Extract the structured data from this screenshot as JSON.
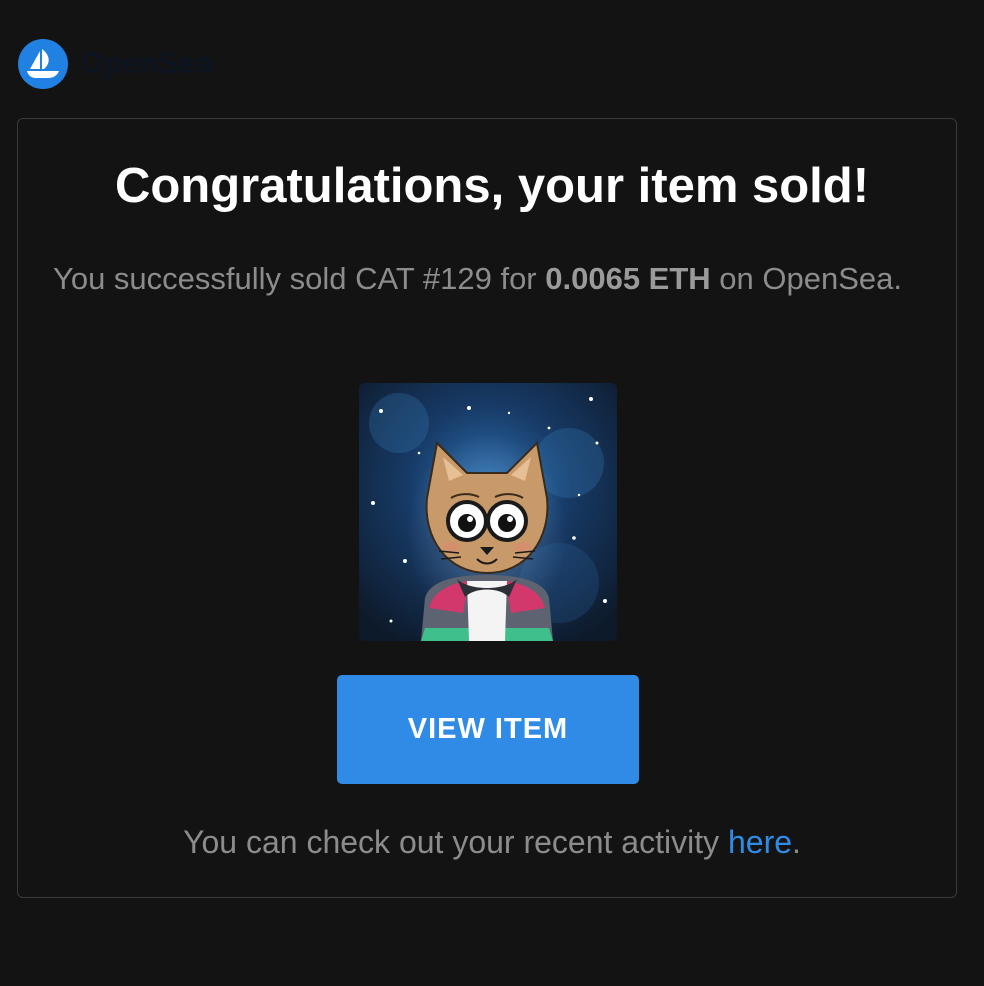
{
  "brand": {
    "name": "OpenSea",
    "logo_icon": "opensea-boat-icon",
    "accent_color": "#2081E2"
  },
  "email": {
    "title": "Congratulations, your item sold!",
    "message_prefix": "You successfully sold CAT #129 for ",
    "price": "0.0065 ETH",
    "message_suffix": " on OpenSea.",
    "item_image_alt": "CAT #129",
    "view_button_label": "VIEW ITEM",
    "footer_prefix": "You can check out your recent activity ",
    "footer_link_label": "here",
    "footer_suffix": "."
  }
}
